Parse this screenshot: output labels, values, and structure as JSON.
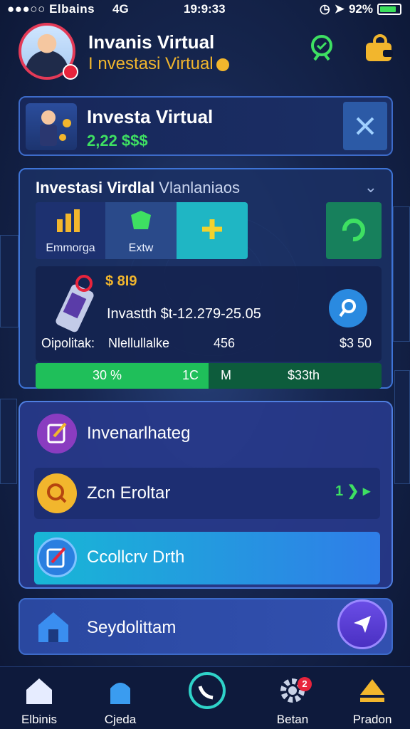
{
  "status_bar": {
    "carrier": "●●●○○ Elbains",
    "network": "4G",
    "time": "19:9:33",
    "battery": "92%"
  },
  "header": {
    "title": "Invanis Virtual",
    "subtitle": "I nvestasi Virtual"
  },
  "card_top": {
    "title": "Investa Virtual",
    "value": "2,22 $$$"
  },
  "panel": {
    "title": "Investasi Virdlal",
    "title_extra": "Vlanlaniaos",
    "tiles": [
      {
        "label": "Emmorga"
      },
      {
        "label": "Extw"
      },
      {
        "label": ""
      },
      {
        "label": ""
      }
    ],
    "amount": "$ 8I9",
    "transaction": "Invastth $t-12.279-25.05",
    "label_a": "Oipolitak:",
    "label_b": "Nlellullalke",
    "label_c": "456",
    "label_d": "$3 50",
    "progress": {
      "fraction": 0.5,
      "t1": "30 %",
      "t2": "1C",
      "t3": "M",
      "t4": "$33th"
    }
  },
  "list": {
    "items": [
      {
        "label": "Invenarlhateg"
      },
      {
        "label": "Zcn Eroltar",
        "right": "1 ❯ ▸"
      },
      {
        "label": "Ccollcrv Drth"
      }
    ]
  },
  "card_bottom": {
    "label": "Seydolittam"
  },
  "tabbar": {
    "tabs": [
      {
        "label": "Elbinis"
      },
      {
        "label": "Cjeda"
      },
      {
        "label": ""
      },
      {
        "label": "Betan",
        "badge": "2"
      },
      {
        "label": "Pradon"
      }
    ]
  },
  "colors": {
    "accent_green": "#3ee062",
    "accent_gold": "#f2b62d",
    "accent_blue": "#2f7de8",
    "badge_red": "#e8243c"
  }
}
